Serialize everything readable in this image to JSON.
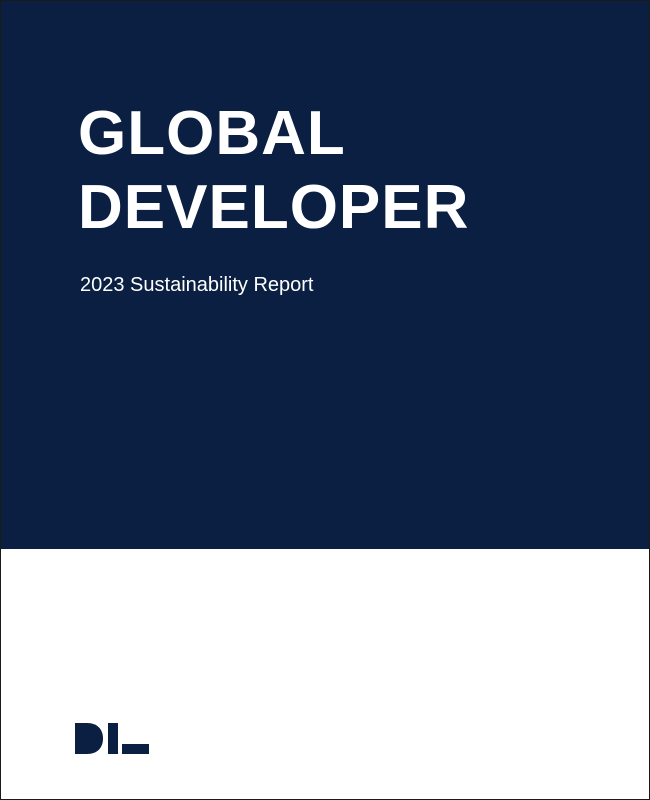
{
  "cover": {
    "title_line1": "GLOBAL",
    "title_line2": "DEVELOPER",
    "subtitle": "2023 Sustainability Report",
    "logo_text": "DL",
    "colors": {
      "navy": "#0b1f42",
      "white": "#ffffff"
    }
  }
}
